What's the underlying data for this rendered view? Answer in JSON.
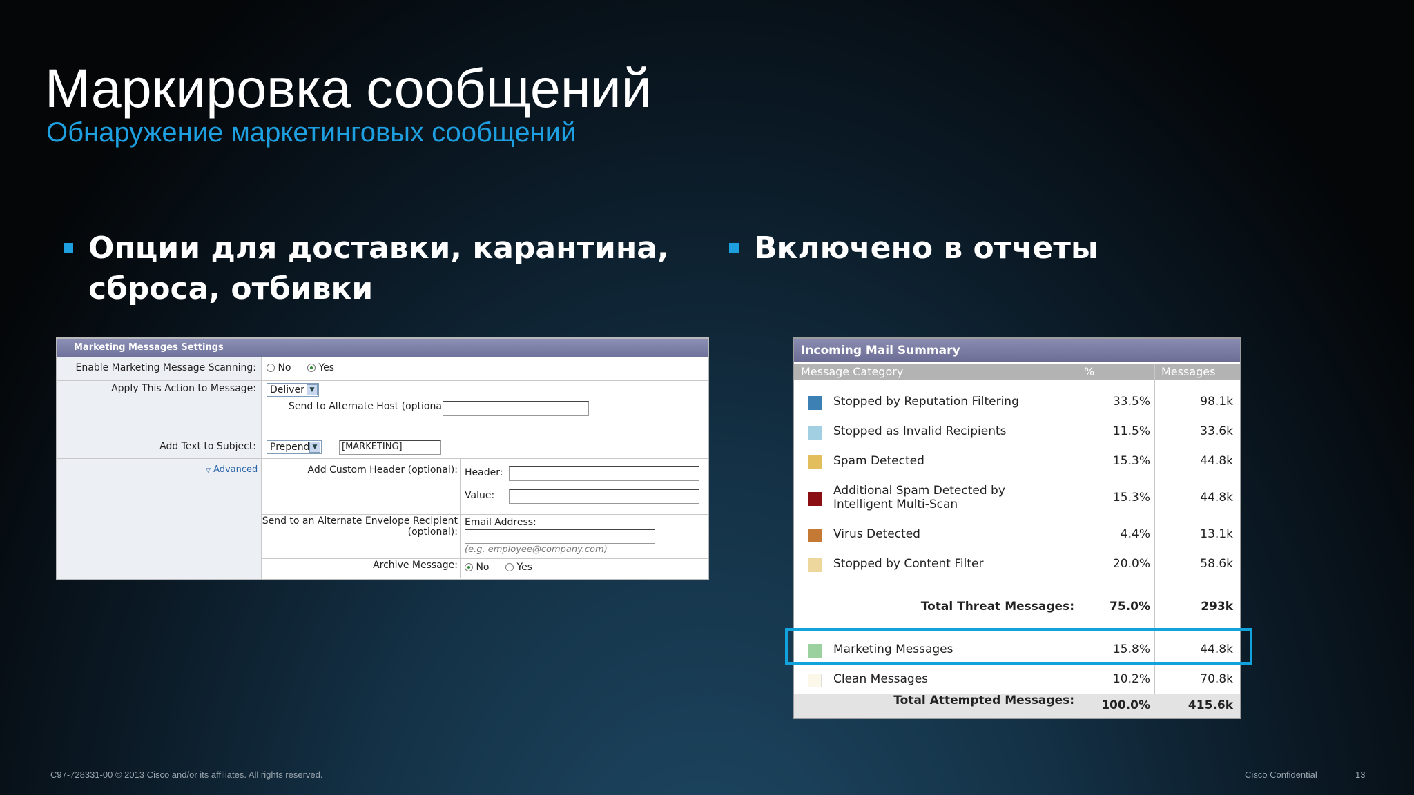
{
  "slide": {
    "title": "Маркировка сообщений",
    "subtitle": "Обнаружение маркетинговых сообщений",
    "bullets": [
      {
        "line1": "Опции для доставки, карантина,",
        "line2": "сброса, отбивки"
      },
      {
        "line1": "Включено в отчеты"
      }
    ],
    "footer_left": "C97-728331-00 © 2013 Cisco and/or its affiliates. All rights reserved.",
    "footer_confidential": "Cisco Confidential",
    "page_number": "13",
    "accent_color": "#1e9fe0"
  },
  "settings": {
    "header": "Marketing Messages Settings",
    "enable_label": "Enable Marketing Message Scanning:",
    "enable_no": "No",
    "enable_yes": "Yes",
    "enable_selected": "Yes",
    "action_label": "Apply This Action to Message:",
    "action_value": "Deliver",
    "alt_host_label": "Send to Alternate Host (optional):",
    "alt_host_value": "",
    "subject_label": "Add Text to Subject:",
    "subject_mode": "Prepend",
    "subject_text": "[MARKETING]",
    "advanced_link": "Advanced",
    "custom_header_label": "Add Custom Header (optional):",
    "header_label": "Header:",
    "value_label": "Value:",
    "envelope_label_1": "Send to an Alternate Envelope Recipient",
    "envelope_label_2": "(optional):",
    "email_label": "Email Address:",
    "email_hint": "(e.g. employee@company.com)",
    "archive_label": "Archive Message:",
    "archive_no": "No",
    "archive_yes": "Yes",
    "archive_selected": "No"
  },
  "summary": {
    "title": "Incoming Mail Summary",
    "columns": [
      "Message Category",
      "%",
      "Messages"
    ],
    "rows": [
      {
        "category": "Stopped by Reputation Filtering",
        "pct": "33.5%",
        "messages": "98.1k",
        "color": "#3c80b4"
      },
      {
        "category": "Stopped as Invalid Recipients",
        "pct": "11.5%",
        "messages": "33.6k",
        "color": "#a3cfe2"
      },
      {
        "category": "Spam Detected",
        "pct": "15.3%",
        "messages": "44.8k",
        "color": "#e2be5c"
      },
      {
        "category_line1": "Additional Spam Detected by",
        "category_line2": "Intelligent Multi-Scan",
        "pct": "15.3%",
        "messages": "44.8k",
        "color": "#8a0e12"
      },
      {
        "category": "Virus Detected",
        "pct": "4.4%",
        "messages": "13.1k",
        "color": "#c47a34"
      },
      {
        "category": "Stopped by Content Filter",
        "pct": "20.0%",
        "messages": "58.6k",
        "color": "#eed79c"
      }
    ],
    "total_threat": {
      "label": "Total Threat Messages:",
      "pct": "75.0%",
      "messages": "293k"
    },
    "marketing": {
      "category": "Marketing Messages",
      "pct": "15.8%",
      "messages": "44.8k",
      "color": "#9bd09f"
    },
    "clean": {
      "category": "Clean Messages",
      "pct": "10.2%",
      "messages": "70.8k",
      "color": "#fbf8ea"
    },
    "total_attempted": {
      "label": "Total Attempted Messages:",
      "pct": "100.0%",
      "messages": "415.6k"
    },
    "highlight_color": "#12a3dc"
  }
}
